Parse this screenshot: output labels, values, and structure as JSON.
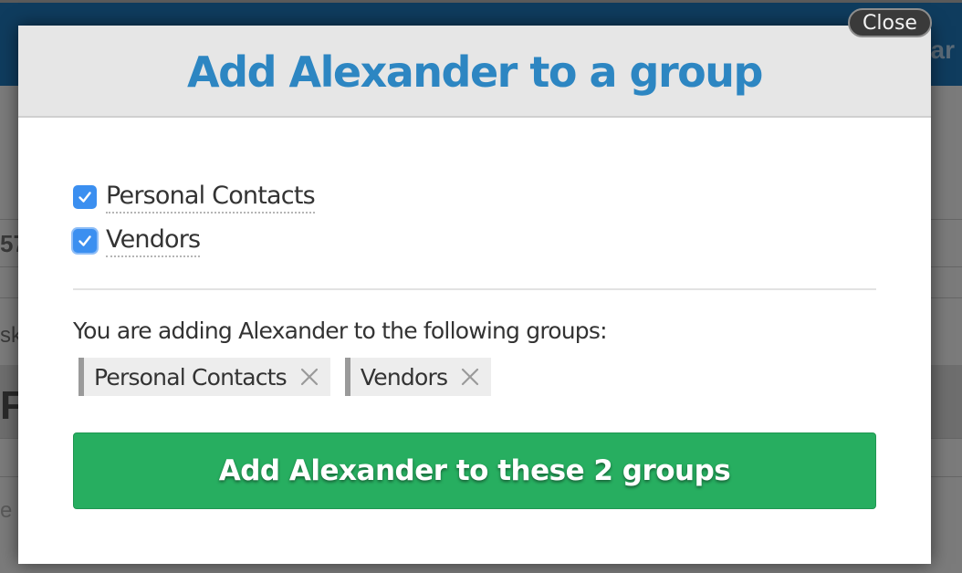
{
  "background": {
    "topbar_fragment": "ar",
    "fragments": [
      "57",
      "sk",
      "F",
      "e a"
    ]
  },
  "close_button": {
    "label": "Close"
  },
  "modal": {
    "title": "Add Alexander to a group",
    "options": [
      {
        "label": "Personal Contacts",
        "checked": true,
        "focused": false
      },
      {
        "label": "Vendors",
        "checked": true,
        "focused": true
      }
    ],
    "summary_text": "You are adding Alexander to the following groups:",
    "selected_groups": [
      {
        "label": "Personal Contacts",
        "remove_icon": "close-x-icon"
      },
      {
        "label": "Vendors",
        "remove_icon": "close-x-icon"
      }
    ],
    "submit_label": "Add Alexander to these 2 groups"
  },
  "colors": {
    "title": "#2d86c2",
    "checkbox": "#3b8ff0",
    "submit": "#27ae60",
    "header_bg": "#e6e6e6",
    "topbar": "#0f3c5e"
  }
}
